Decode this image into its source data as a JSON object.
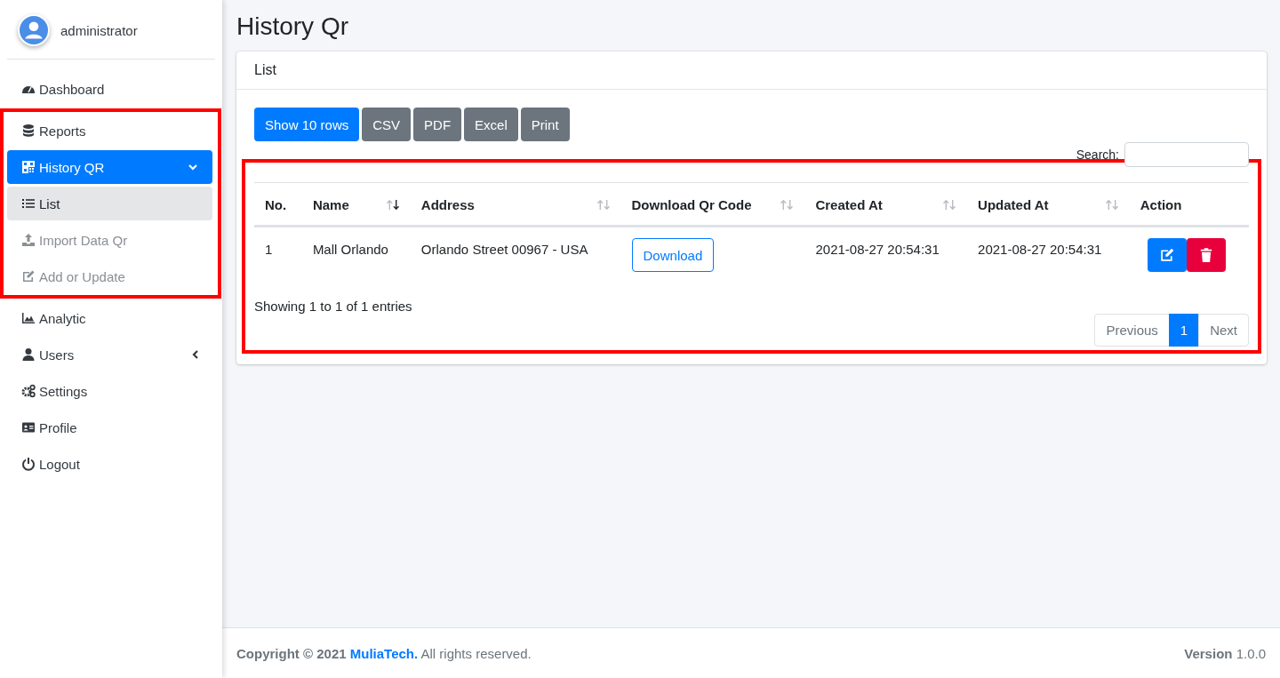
{
  "user": {
    "name": "administrator"
  },
  "sidebar": {
    "items": [
      {
        "label": "Dashboard",
        "selected": false,
        "highlighted": false
      },
      {
        "label": "Reports",
        "selected": false,
        "highlighted": true
      },
      {
        "label": "History QR",
        "selected": true,
        "highlighted": true,
        "expanded": true,
        "children": [
          {
            "label": "List",
            "selected": true
          },
          {
            "label": "Import Data Qr",
            "selected": false
          },
          {
            "label": "Add or Update",
            "selected": false
          }
        ]
      },
      {
        "label": "Analytic",
        "selected": false,
        "highlighted": false
      },
      {
        "label": "Users",
        "selected": false,
        "highlighted": false,
        "expanded": false
      },
      {
        "label": "Settings",
        "selected": false,
        "highlighted": false
      },
      {
        "label": "Profile",
        "selected": false,
        "highlighted": false
      },
      {
        "label": "Logout",
        "selected": false,
        "highlighted": false
      }
    ]
  },
  "page_title": "History Qr",
  "card": {
    "title": "List",
    "buttons": [
      {
        "label": "Show 10 rows",
        "kind": "primary"
      },
      {
        "label": "CSV",
        "kind": "secondary"
      },
      {
        "label": "PDF",
        "kind": "secondary"
      },
      {
        "label": "Excel",
        "kind": "secondary"
      },
      {
        "label": "Print",
        "kind": "secondary"
      }
    ],
    "search": {
      "label": "Search:"
    },
    "table": {
      "highlighted": true,
      "columns": [
        {
          "label": "No.",
          "sortable": false
        },
        {
          "label": "Name",
          "sortable": true,
          "sorted": true
        },
        {
          "label": "Address",
          "sortable": true,
          "sorted": false
        },
        {
          "label": "Download Qr Code",
          "sortable": true,
          "sorted": false
        },
        {
          "label": "Created At",
          "sortable": true,
          "sorted": false
        },
        {
          "label": "Updated At",
          "sortable": true,
          "sorted": false
        },
        {
          "label": "Action",
          "sortable": false
        }
      ],
      "rows": [
        {
          "no": "1",
          "name": "Mall Orlando",
          "address": "Orlando Street 00967 - USA",
          "download": "Download",
          "created": "2021-08-27 20:54:31",
          "updated": "2021-08-27 20:54:31"
        }
      ],
      "info": "Showing 1 to 1 of 1 entries",
      "pagination": [
        {
          "label": "Previous",
          "selected": false
        },
        {
          "label": "1",
          "selected": true
        },
        {
          "label": "Next",
          "selected": false
        }
      ]
    }
  },
  "footer": {
    "copyright": "**Copyright © 2021**",
    "link": "MuliaTech.",
    "rest": "All rights reserved.",
    "version": "**Version** 1.0.0"
  }
}
